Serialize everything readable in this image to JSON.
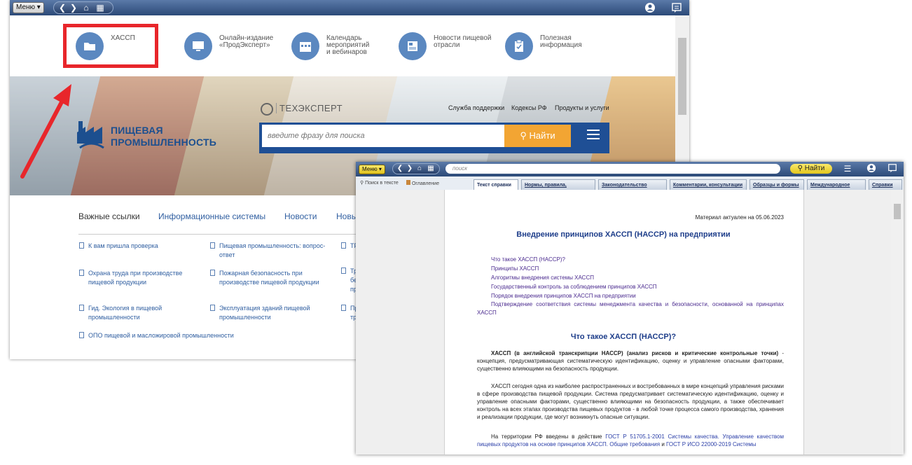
{
  "main_window": {
    "topbar": {
      "menu_label": "Меню ▾"
    },
    "quick_links": [
      {
        "label": "ХАССП"
      },
      {
        "label": "Онлайн-издание\n«ПродЭксперт»"
      },
      {
        "label": "Календарь\nмероприятий\nи вебинаров"
      },
      {
        "label": "Новости пищевой\nотрасли"
      },
      {
        "label": "Полезная\nинформация"
      }
    ],
    "banner": {
      "brand_line1": "ПИЩЕВАЯ",
      "brand_line2": "ПРОМЫШЛЕННОСТЬ",
      "techexpert": "ТЕХЭКСПЕРТ",
      "top_links": [
        "Служба поддержки",
        "Кодексы РФ",
        "Продукты и услуги"
      ],
      "search_placeholder": "введите фразу для поиска",
      "search_button": "Найти"
    },
    "tabs": [
      "Важные ссылки",
      "Информационные системы",
      "Новости",
      "Новы"
    ],
    "links": {
      "col1": [
        "К вам пришла проверка",
        "Охрана труда при производстве\nпищевой продукции",
        "Гид. Экология в пищевой\nпромышленности",
        "ОПО пищевой и масложировой промышленности"
      ],
      "col2": [
        "Пищевая промышленность: вопрос-\nответ",
        "Пожарная безопасность при\nпроизводстве пищевой продукции",
        "Эксплуатация зданий пищевой\nпромышленности"
      ],
      "col3": [
        "ТР",
        "Тр\nбе\nпр",
        "Пр\nтр"
      ]
    }
  },
  "doc_window": {
    "menu_label": "Меню ▾",
    "search_placeholder": "поиск",
    "find_button": "Найти",
    "tools": [
      "Поиск в тексте",
      "Оглавление"
    ],
    "tabs": [
      "Текст справки",
      "Нормы, правила, стандарты",
      "Законодательство России",
      "Комментарии, консультации",
      "Образцы и формы",
      "Международное право",
      "Справки"
    ],
    "actual": "Материал актуален на 05.06.2023",
    "title": "Внедрение принципов ХАССП (НАССР) на предприятии",
    "toc": [
      "Что такое ХАССП (НАССР)?",
      "Принципы ХАССП",
      "Алгоритмы внедрения системы ХАССП",
      "Государственный контроль за соблюдением принципов ХАССП",
      "Порядок внедрения принципов ХАССП на предприятии",
      "Подтверждение соответствия системы менеджмента качества и безопасности, основанной на принципах ХАССП"
    ],
    "section_title": "Что такое ХАССП (НАССР)?",
    "para1_bold": "ХАССП (в английской транскрипции НАССР) (анализ рисков и критические контрольные точки)",
    "para1_rest": " - концепция, предусматривающая систематическую идентификацию, оценку и управление опасными факторами, существенно влияющими на безопасность продукции.",
    "para2": "ХАССП сегодня одна из наиболее распространенных и востребованных в мире концепций управления рисками в сфере производства пищевой продукции. Система предусматривает систематическую идентификацию, оценку и управление опасными факторами, существенно влияющими на безопасность продукции, а также обеспечивает контроль на всех этапах производства пищевых продуктов - в любой точке процесса самого производства, хранения и реализации продукции, где могут возникнуть опасные ситуации.",
    "para3_start": "На территории РФ введены в действие ",
    "para3_link1": "ГОСТ Р 51705.1-2001 Системы качества. Управление качеством пищевых продуктов на основе принципов ХАССП. Общие требования",
    "para3_mid": " и ",
    "para3_link2": "ГОСТ Р ИСО 22000-2019 Системы"
  }
}
